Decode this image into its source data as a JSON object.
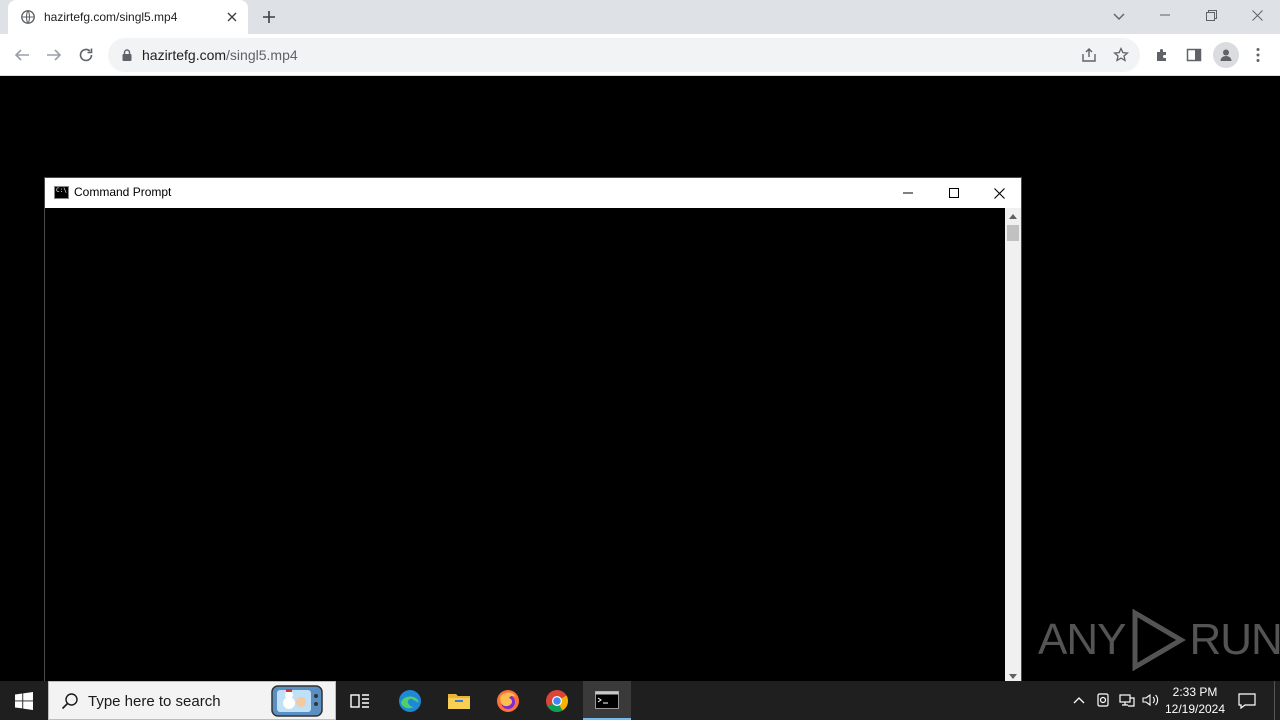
{
  "browser": {
    "tab": {
      "title": "hazirtefg.com/singl5.mp4"
    },
    "address": {
      "host": "hazirtefg.com",
      "path": "/singl5.mp4"
    }
  },
  "cmd_window": {
    "title": "Command Prompt",
    "icon_label": "C:\\"
  },
  "watermark": {
    "text": "ANY",
    "text2": "RUN"
  },
  "taskbar": {
    "search_placeholder": "Type here to search",
    "apps": [
      "task-view",
      "edge",
      "file-explorer",
      "firefox",
      "chrome",
      "command-prompt"
    ],
    "active_app": "command-prompt",
    "clock": {
      "time": "2:33 PM",
      "date": "12/19/2024"
    }
  },
  "colors": {
    "chrome_tabstrip": "#dee1e6",
    "taskbar": "#1f1f1f",
    "active_underline": "#76b9ed"
  }
}
